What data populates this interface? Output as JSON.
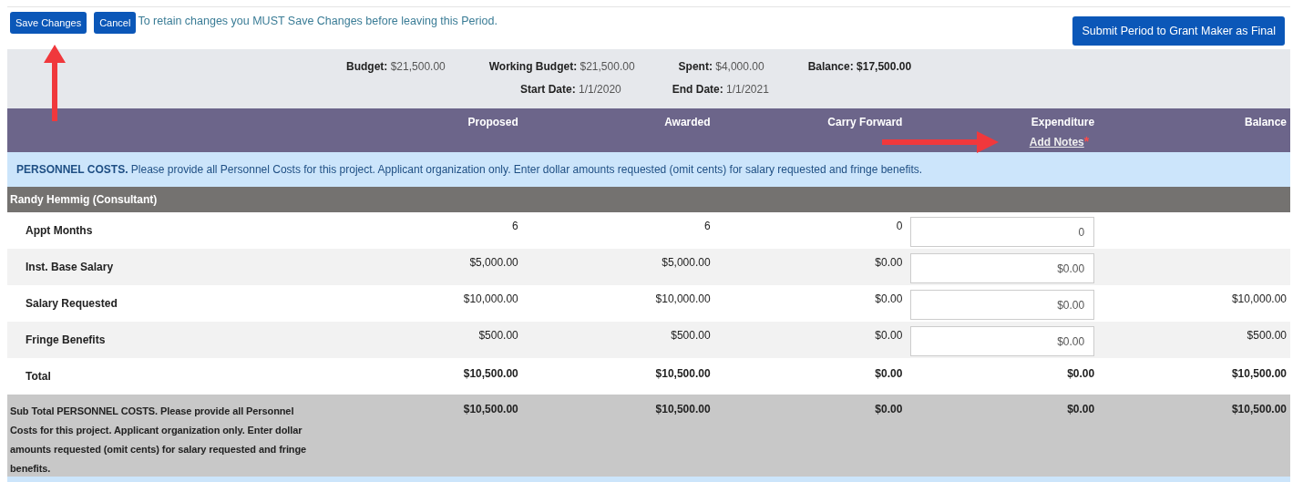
{
  "toolbar": {
    "buttons": [
      "Save Changes",
      "Cancel"
    ],
    "notice": "To retain changes you MUST Save Changes before leaving this Period.",
    "submit_button": "Submit Period to Grant Maker as Final"
  },
  "summary": [
    [
      {
        "label": "Budget:",
        "value": "$21,500.00",
        "bold": false
      },
      {
        "label": "Working Budget:",
        "value": "$21,500.00",
        "bold": false
      },
      {
        "label": "Spent:",
        "value": "$4,000.00",
        "bold": false
      },
      {
        "label": "Balance:",
        "value": "$17,500.00",
        "bold": true
      }
    ],
    [
      {
        "label": "Start Date:",
        "value": "1/1/2020",
        "bold": false
      },
      {
        "label": "End Date:",
        "value": "1/1/2021",
        "bold": false
      }
    ]
  ],
  "table": {
    "columns": [
      "Proposed",
      "Awarded",
      "Carry Forward",
      "Expenditure",
      "Balance"
    ],
    "notes_link": "Add Notes",
    "notes_required": "*",
    "section": {
      "title": "PERSONNEL COSTS.",
      "description": "Please provide all Personnel Costs for this project. Applicant organization only. Enter dollar amounts requested (omit cents) for salary requested and fringe benefits."
    },
    "group": "Randy Hemmig (Consultant)",
    "rows": [
      {
        "kind": "input",
        "label": "Appt Months",
        "proposed": "6",
        "awarded": "6",
        "carry_forward": "0",
        "expenditure": "0"
      },
      {
        "kind": "input",
        "label": "Inst. Base Salary",
        "proposed": "$5,000.00",
        "awarded": "$5,000.00",
        "carry_forward": "$0.00",
        "expenditure": "$0.00"
      },
      {
        "kind": "input",
        "label": "Salary Requested",
        "proposed": "$10,000.00",
        "awarded": "$10,000.00",
        "carry_forward": "$0.00",
        "expenditure": "$0.00",
        "balance": "$10,000.00"
      },
      {
        "kind": "input",
        "label": "Fringe Benefits",
        "proposed": "$500.00",
        "awarded": "$500.00",
        "carry_forward": "$0.00",
        "expenditure": "$0.00",
        "balance": "$500.00"
      },
      {
        "kind": "total",
        "label": "Total",
        "proposed": "$10,500.00",
        "awarded": "$10,500.00",
        "carry_forward": "$0.00",
        "expenditure": "$0.00",
        "balance": "$10,500.00"
      },
      {
        "kind": "subtotal",
        "label": "Sub Total PERSONNEL COSTS. Please provide all Personnel Costs for this project. Applicant organization only. Enter dollar amounts requested (omit cents) for salary requested and fringe benefits.",
        "proposed": "$10,500.00",
        "awarded": "$10,500.00",
        "carry_forward": "$0.00",
        "expenditure": "$0.00",
        "balance": "$10,500.00"
      }
    ]
  }
}
